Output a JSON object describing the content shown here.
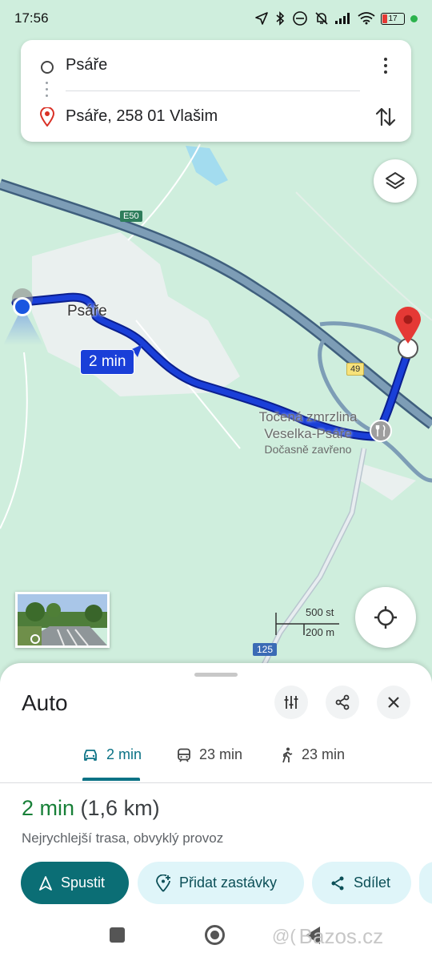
{
  "status_bar": {
    "time": "17:56",
    "battery_level": "17"
  },
  "route_card": {
    "origin": "Psáře",
    "destination": "Psáře, 258 01 Vlašim"
  },
  "map": {
    "town_label": "Psáře",
    "route_time_badge": "2 min",
    "poi_name": "Točená zmrzlina Veselka-Psáře",
    "poi_status": "Dočasně zavřeno",
    "road_e50": "E50",
    "road_49": "49",
    "road_125": "125",
    "scale_imperial": "500 st",
    "scale_metric": "200 m"
  },
  "sheet": {
    "title": "Auto",
    "tabs": [
      {
        "mode": "car",
        "label": "2 min",
        "active": true
      },
      {
        "mode": "transit",
        "label": "23 min",
        "active": false
      },
      {
        "mode": "walk",
        "label": "23 min",
        "active": false
      }
    ],
    "summary_duration": "2 min",
    "summary_distance": "(1,6 km)",
    "description": "Nejrychlejší trasa, obvyklý provoz",
    "actions": {
      "start": "Spustit",
      "add_stops": "Přidat zastávky",
      "share": "Sdílet"
    }
  },
  "watermark": "Bazos.cz",
  "colors": {
    "route": "#1a3fd8",
    "accent": "#0b6e75",
    "highway": "#5b7a95",
    "duration_green": "#188038",
    "pin_red": "#e53935"
  }
}
